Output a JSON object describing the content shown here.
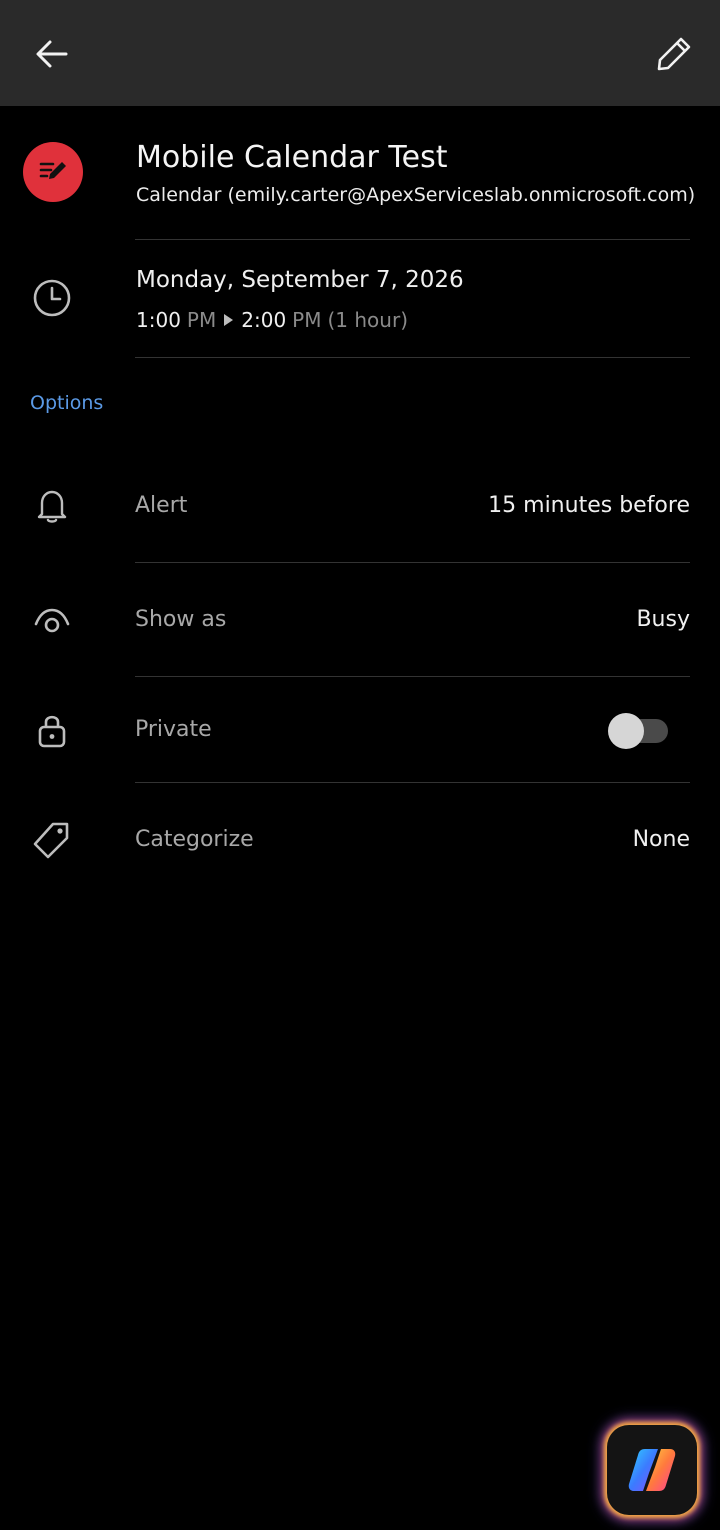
{
  "header": {
    "back_icon": "arrow-left-icon",
    "edit_icon": "pencil-icon"
  },
  "event": {
    "title": "Mobile Calendar Test",
    "calendar": "Calendar (emily.carter@ApexServiceslab.onmicrosoft.com)",
    "badge_color": "#e0313b",
    "badge_icon": "edit-note-icon"
  },
  "schedule": {
    "date": "Monday, September 7, 2026",
    "start_time": "1:00",
    "start_period": "PM",
    "end_time": "2:00",
    "end_period": "PM",
    "duration": "(1 hour)",
    "icon": "clock-icon"
  },
  "options": {
    "header": "Options",
    "header_color": "#5b9ae6",
    "alert": {
      "label": "Alert",
      "value": "15 minutes before",
      "icon": "bell-icon"
    },
    "show_as": {
      "label": "Show as",
      "value": "Busy",
      "icon": "eye-icon"
    },
    "private": {
      "label": "Private",
      "enabled": false,
      "icon": "lock-icon"
    },
    "categorize": {
      "label": "Categorize",
      "value": "None",
      "icon": "tag-icon"
    }
  },
  "fab": {
    "icon": "copilot-icon"
  }
}
